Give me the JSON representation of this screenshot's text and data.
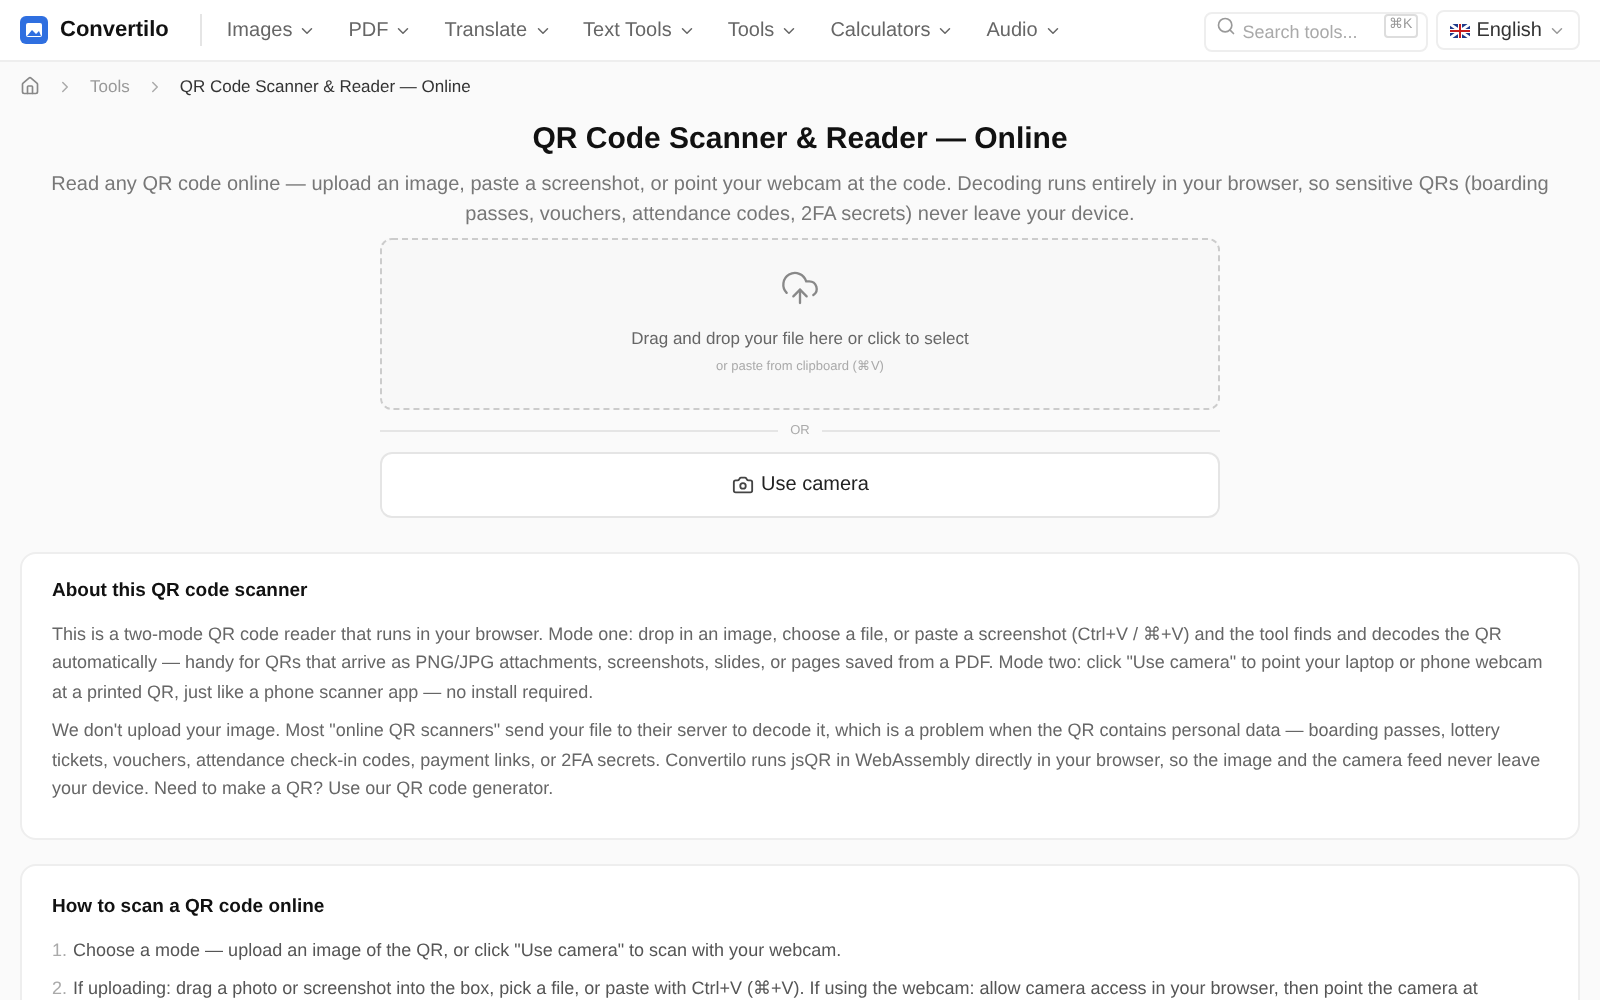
{
  "header": {
    "logo": "Convertilo",
    "nav": [
      {
        "label": "Images"
      },
      {
        "label": "PDF"
      },
      {
        "label": "Translate"
      },
      {
        "label": "Text Tools"
      },
      {
        "label": "Tools"
      },
      {
        "label": "Calculators"
      },
      {
        "label": "Audio"
      }
    ],
    "search": {
      "placeholder": "Search tools...",
      "shortcut": "⌘K"
    },
    "language": "English"
  },
  "breadcrumb": [
    "Tools",
    "QR Code Scanner & Reader — Online"
  ],
  "title": "QR Code Scanner & Reader — Online",
  "description": "Read any QR code online — upload an image, paste a screenshot, or point your webcam at the code. Decoding runs entirely in your browser, so sensitive QRs (boarding passes, vouchers, attendance codes, 2FA secrets) never leave your device.",
  "dropzone": {
    "text": "Drag and drop your file here or click to select",
    "hint": "or paste from clipboard (⌘V)"
  },
  "divider": "OR",
  "camera_button": "Use camera",
  "about": {
    "heading": "About this QR code scanner",
    "paragraphs": [
      "This is a two-mode QR code reader that runs in your browser. Mode one: drop in an image, choose a file, or paste a screenshot (Ctrl+V / ⌘+V) and the tool finds and decodes the QR automatically — handy for QRs that arrive as PNG/JPG attachments, screenshots, slides, or pages saved from a PDF. Mode two: click \"Use camera\" to point your laptop or phone webcam at a printed QR, just like a phone scanner app — no install required.",
      "We don't upload your image. Most \"online QR scanners\" send your file to their server to decode it, which is a problem when the QR contains personal data — boarding passes, lottery tickets, vouchers, attendance check-in codes, payment links, or 2FA secrets. Convertilo runs jsQR in WebAssembly directly in your browser, so the image and the camera feed never leave your device. Need to make a QR? Use our QR code generator."
    ]
  },
  "howto": {
    "heading": "How to scan a QR code online",
    "steps": [
      {
        "number": "1.",
        "text": "Choose a mode — upload an image of the QR, or click \"Use camera\" to scan with your webcam."
      },
      {
        "number": "2.",
        "text": "If uploading: drag a photo or screenshot into the box, pick a file, or paste with Ctrl+V (⌘+V). If using the webcam: allow camera access in your browser, then point the camera at"
      }
    ]
  }
}
